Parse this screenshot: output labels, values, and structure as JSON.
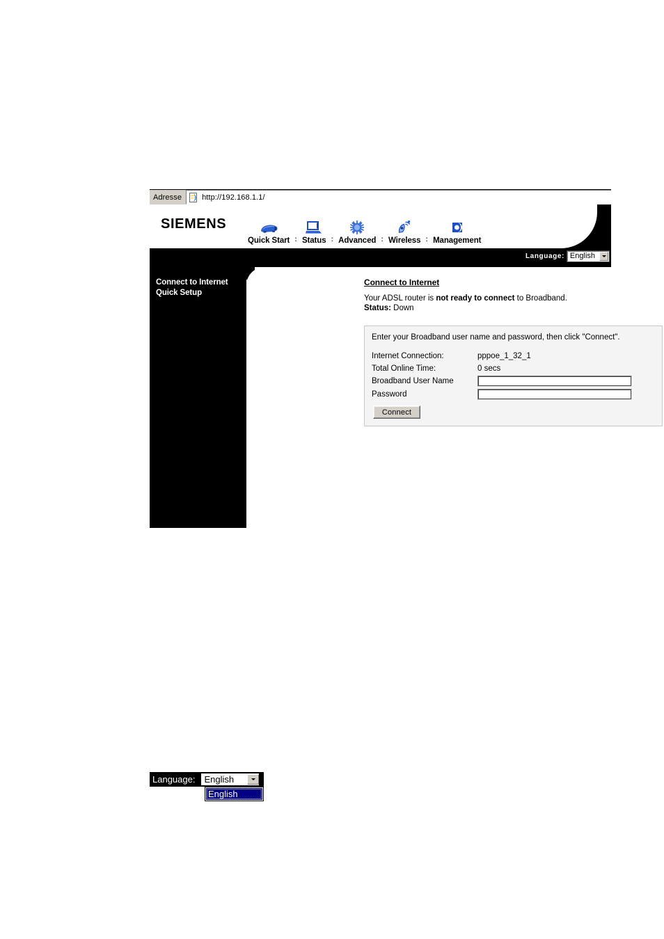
{
  "browser": {
    "address_label": "Adresse",
    "url": "http://192.168.1.1/",
    "icon": "ie-page-icon"
  },
  "header": {
    "brand": "SIEMENS",
    "nav": [
      {
        "label": "Quick Start",
        "icon": "car-icon"
      },
      {
        "label": "Status",
        "icon": "laptop-icon"
      },
      {
        "label": "Advanced",
        "icon": "chip-icon"
      },
      {
        "label": "Wireless",
        "icon": "satellite-dish-icon"
      },
      {
        "label": "Management",
        "icon": "key-disc-icon"
      }
    ],
    "separator": ":",
    "language_label": "Language:",
    "language_value": "English"
  },
  "sidebar": {
    "items": [
      {
        "label": "Connect to Internet"
      },
      {
        "label": "Quick Setup"
      }
    ]
  },
  "content": {
    "title": "Connect to Internet",
    "status_prefix": "Your ADSL router is ",
    "status_bold": "not ready to connect",
    "status_suffix": " to Broadband.",
    "status_label": "Status:",
    "status_value": " Down",
    "panel": {
      "instruction": "Enter your Broadband user name and password, then click \"Connect\".",
      "rows": [
        {
          "label": "Internet Connection:",
          "value": "pppoe_1_32_1"
        },
        {
          "label": "Total Online Time:",
          "value": "0 secs"
        },
        {
          "label": "Broadband User Name",
          "input_value": "",
          "input_placeholder": ""
        },
        {
          "label": "Password",
          "input_value": "",
          "input_placeholder": ""
        }
      ],
      "connect_button": "Connect"
    }
  },
  "language_widget": {
    "label": "Language:",
    "selected": "English",
    "options": [
      "English"
    ]
  },
  "colors": {
    "brand_black": "#000000",
    "nav_icon_blue": "#1f4fc4",
    "panel_bg": "#f4f4f4",
    "highlight_blue": "#000080"
  }
}
